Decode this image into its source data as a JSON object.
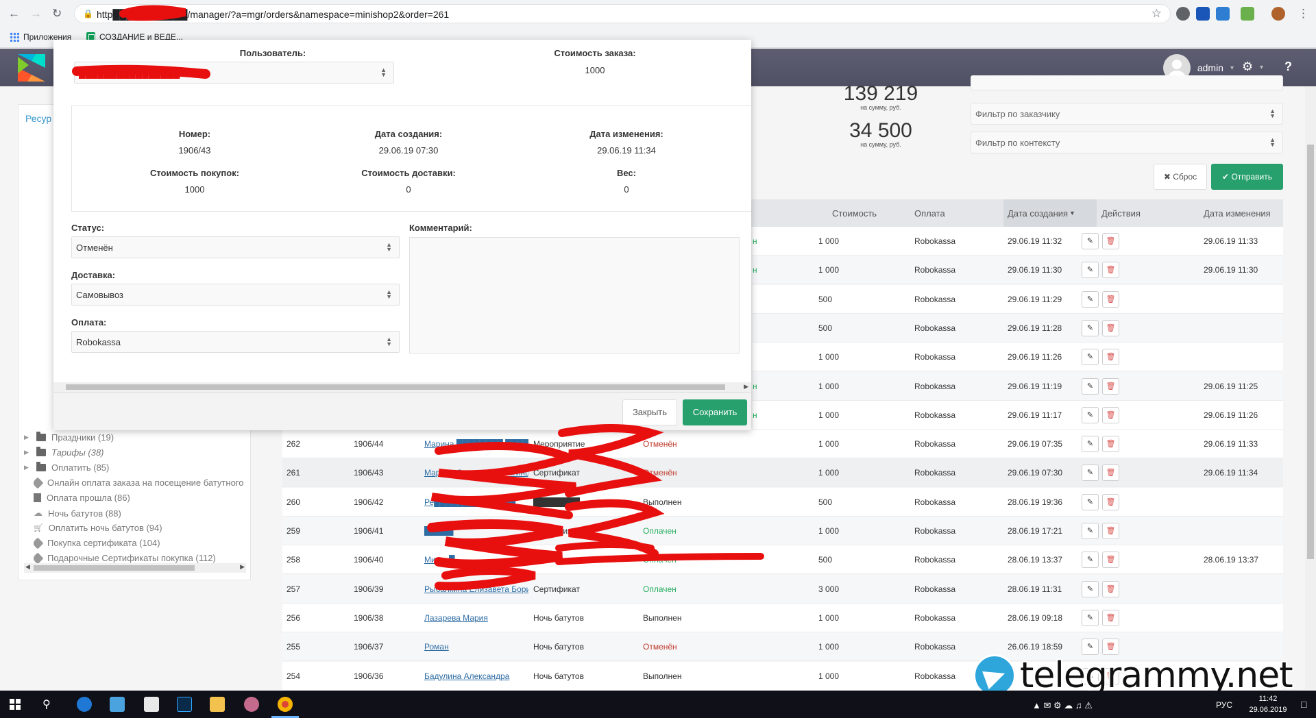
{
  "browser": {
    "url": "http███████████/manager/?a=mgr/orders&namespace=minishop2&order=261",
    "bookmarks": [
      {
        "label": "Приложения",
        "icon": "apps-grid-icon"
      },
      {
        "label": "СОЗДАНИЕ и ВЕДЕ...",
        "icon": "sheets-icon"
      }
    ]
  },
  "header": {
    "username": "admin"
  },
  "tree": {
    "tab_label": "Ресур",
    "items": [
      {
        "label": "Праздники (19)",
        "icon": "folder",
        "italic": false
      },
      {
        "label": "Тарифы (38)",
        "icon": "folder",
        "italic": true
      },
      {
        "label": "Оплатить (85)",
        "icon": "folder",
        "italic": false
      },
      {
        "label": "Онлайн оплата заказа на посещение батутного",
        "icon": "tag",
        "italic": false
      },
      {
        "label": "Оплата прошла (86)",
        "icon": "page",
        "italic": false
      },
      {
        "label": "Ночь батутов (88)",
        "icon": "cloud",
        "italic": false
      },
      {
        "label": "Оплатить ночь батутов (94)",
        "icon": "cart",
        "italic": false
      },
      {
        "label": "Покупка сертификата (104)",
        "icon": "tag",
        "italic": false
      },
      {
        "label": "Подарочные Сертификаты покупка (112)",
        "icon": "tag",
        "italic": false
      }
    ]
  },
  "stats": {
    "top_value": "139 219",
    "top_caption": "на сумму, руб.",
    "bottom_value": "34 500",
    "bottom_caption": "на сумму, руб."
  },
  "filters": {
    "customer": "Фильтр по заказчику",
    "context": "Фильтр по контексту",
    "reset_label": "Сброс",
    "send_label": "Отправить"
  },
  "grid": {
    "columns": {
      "cost": "Стоимость",
      "payment": "Оплата",
      "created": "Дата создания",
      "actions": "Действия",
      "updated": "Дата изменения"
    },
    "top_rows": [
      {
        "status_tail": "н",
        "cost": "1 000",
        "payment": "Robokassa",
        "created": "29.06.19 11:32",
        "updated": "29.06.19 11:33"
      },
      {
        "status_tail": "н",
        "cost": "1 000",
        "payment": "Robokassa",
        "created": "29.06.19 11:30",
        "updated": "29.06.19 11:30"
      },
      {
        "status_tail": "",
        "cost": "500",
        "payment": "Robokassa",
        "created": "29.06.19 11:29",
        "updated": ""
      },
      {
        "status_tail": "",
        "cost": "500",
        "payment": "Robokassa",
        "created": "29.06.19 11:28",
        "updated": ""
      },
      {
        "status_tail": "",
        "cost": "1 000",
        "payment": "Robokassa",
        "created": "29.06.19 11:26",
        "updated": ""
      },
      {
        "status_tail": "н",
        "cost": "1 000",
        "payment": "Robokassa",
        "created": "29.06.19 11:19",
        "updated": "29.06.19 11:25"
      },
      {
        "status_tail": "н",
        "cost": "1 000",
        "payment": "Robokassa",
        "created": "29.06.19 11:17",
        "updated": "29.06.19 11:26"
      }
    ],
    "rows": [
      {
        "id": "262",
        "num": "1906/44",
        "customer": "Марина ████████ ████",
        "delivery": "Мероприятие",
        "status": "Отменён",
        "status_kind": "cancel",
        "cost": "1 000",
        "payment": "Robokassa",
        "created": "29.06.19 07:35",
        "updated": "29.06.19 11:33"
      },
      {
        "id": "261",
        "num": "1906/43",
        "customer": "Марина Сергеевна Звягинц...",
        "delivery": "Сертификат",
        "status": "Отменён",
        "status_kind": "cancel",
        "cost": "1 000",
        "payment": "Robokassa",
        "created": "29.06.19 07:30",
        "updated": "29.06.19 11:34"
      },
      {
        "id": "260",
        "num": "1906/42",
        "customer": "Ре██████████████",
        "delivery": "████████",
        "status": "Выполнен",
        "status_kind": "done",
        "cost": "500",
        "payment": "Robokassa",
        "created": "28.06.19 19:36",
        "updated": ""
      },
      {
        "id": "259",
        "num": "1906/41",
        "customer": "█████",
        "delivery": "Мероприятие",
        "status": "Оплачен",
        "status_kind": "paid",
        "cost": "1 000",
        "payment": "Robokassa",
        "created": "28.06.19 17:21",
        "updated": ""
      },
      {
        "id": "258",
        "num": "1906/40",
        "customer": "Михаи█",
        "delivery": "",
        "status": "Оплачен",
        "status_kind": "paid",
        "cost": "500",
        "payment": "Robokassa",
        "created": "28.06.19 13:37",
        "updated": "28.06.19 13:37"
      },
      {
        "id": "257",
        "num": "1906/39",
        "customer": "Рыбалкина Елизавета Бори...",
        "delivery": "Сертификат",
        "status": "Оплачен",
        "status_kind": "paid",
        "cost": "3 000",
        "payment": "Robokassa",
        "created": "28.06.19 11:31",
        "updated": ""
      },
      {
        "id": "256",
        "num": "1906/38",
        "customer": "Лазарева Мария",
        "delivery": "Ночь батутов",
        "status": "Выполнен",
        "status_kind": "done",
        "cost": "1 000",
        "payment": "Robokassa",
        "created": "28.06.19 09:18",
        "updated": ""
      },
      {
        "id": "255",
        "num": "1906/37",
        "customer": "Роман",
        "delivery": "Ночь батутов",
        "status": "Отменён",
        "status_kind": "cancel",
        "cost": "1 000",
        "payment": "Robokassa",
        "created": "26.06.19 18:59",
        "updated": ""
      },
      {
        "id": "254",
        "num": "1906/36",
        "customer": "Бадулина Александра",
        "delivery": "Ночь батутов",
        "status": "Выполнен",
        "status_kind": "done",
        "cost": "1 000",
        "payment": "Robokassa",
        "created": "",
        "updated": ""
      }
    ]
  },
  "modal": {
    "user_label": "Пользователь:",
    "user_value": "████████████████",
    "order_cost_label": "Стоимость заказа:",
    "order_cost_value": "1000",
    "number_label": "Номер:",
    "number_value": "1906/43",
    "created_label": "Дата создания:",
    "created_value": "29.06.19 07:30",
    "updated_label": "Дата изменения:",
    "updated_value": "29.06.19 11:34",
    "goods_cost_label": "Стоимость покупок:",
    "goods_cost_value": "1000",
    "delivery_cost_label": "Стоимость доставки:",
    "delivery_cost_value": "0",
    "weight_label": "Вес:",
    "weight_value": "0",
    "status_label": "Статус:",
    "status_value": "Отменён",
    "delivery_label": "Доставка:",
    "delivery_value": "Самовывоз",
    "payment_label": "Оплата:",
    "payment_value": "Robokassa",
    "comment_label": "Комментарий:",
    "close_label": "Закрыть",
    "save_label": "Сохранить"
  },
  "watermark": {
    "text": "telegrammy.net"
  },
  "taskbar": {
    "lang": "РУС",
    "time": "11:42",
    "date": "29.06.2019"
  },
  "colors": {
    "accent_green": "#28a06d",
    "header_bg": "#55566a",
    "link_blue": "#2e6da4",
    "status_cancel": "#c0392b",
    "status_paid": "#27ae60",
    "scribble_red": "#e8100f"
  }
}
